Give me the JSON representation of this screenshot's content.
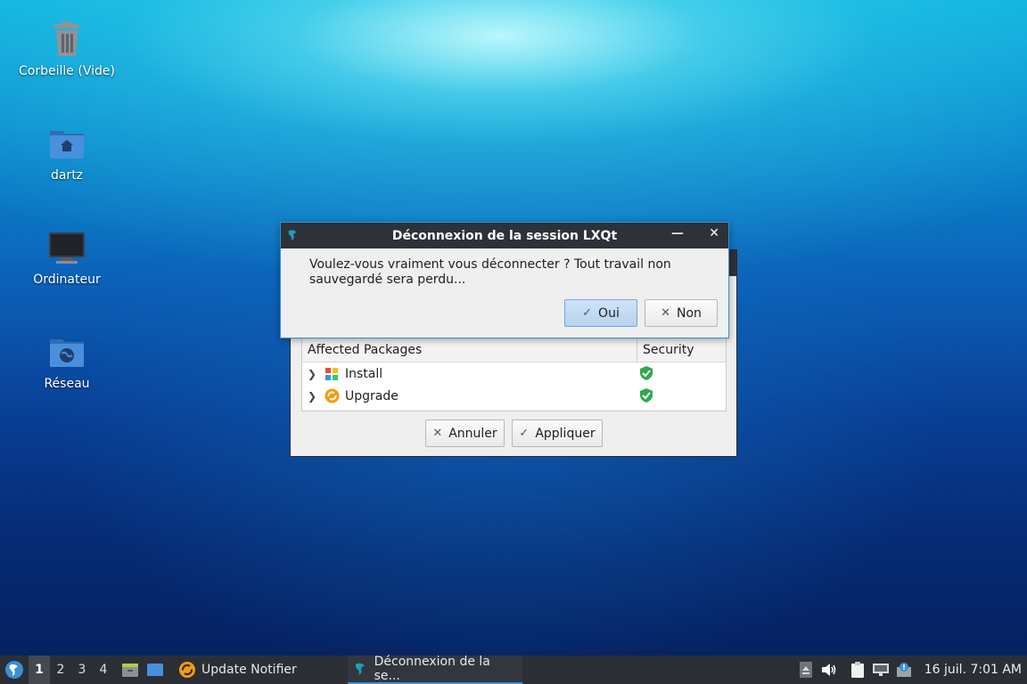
{
  "desktop": {
    "icons": [
      {
        "label": "Corbeille (Vide)",
        "icon": "trash-icon"
      },
      {
        "label": "dartz",
        "icon": "home-folder-icon"
      },
      {
        "label": "Ordinateur",
        "icon": "computer-icon"
      },
      {
        "label": "Réseau",
        "icon": "network-folder-icon"
      }
    ]
  },
  "update_window": {
    "table": {
      "headers": [
        "Affected Packages",
        "Security"
      ],
      "rows": [
        {
          "name": "Install",
          "icon": "install-package-icon",
          "security_icon": "green-shield-icon"
        },
        {
          "name": "Upgrade",
          "icon": "upgrade-package-icon",
          "security_icon": "green-shield-icon"
        }
      ]
    },
    "buttons": {
      "cancel": "Annuler",
      "apply": "Appliquer"
    }
  },
  "logout_dialog": {
    "title": "Déconnexion de la session LXQt",
    "message": "Voulez-vous vraiment vous déconnecter ? Tout travail non sauvegardé sera perdu...",
    "buttons": {
      "yes": "Oui",
      "no": "Non"
    }
  },
  "taskbar": {
    "workspaces": [
      "1",
      "2",
      "3",
      "4"
    ],
    "active_workspace": "1",
    "tasks": [
      {
        "label": "Update Notifier",
        "icon": "update-notifier-icon"
      },
      {
        "label": "Déconnexion de la se...",
        "icon": "lxqt-icon"
      }
    ],
    "clock": "16 juil. 7:01 AM"
  },
  "colors": {
    "accent": "#3a8fd6",
    "titlebar": "#2e3138",
    "taskbar": "#2b2e35",
    "shield": "#2fa84f"
  }
}
